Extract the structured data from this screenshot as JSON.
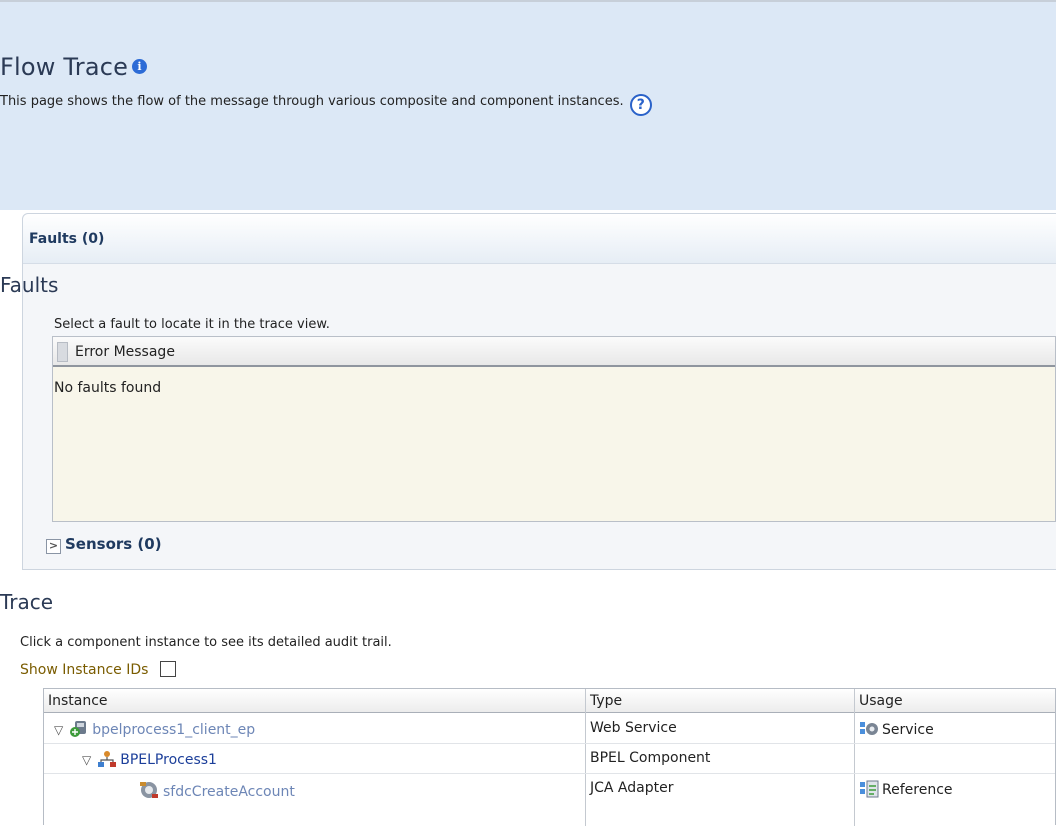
{
  "page": {
    "title": "Flow Trace",
    "description": "This page shows the flow of the message through various composite and component instances."
  },
  "faults": {
    "panel_header": "Faults (0)",
    "heading": "Faults",
    "instruction": "Select a fault to locate it in the trace view.",
    "column_header": "Error Message",
    "empty_text": "No faults found"
  },
  "sensors": {
    "label": "Sensors (0)",
    "expand_glyph": ">"
  },
  "trace": {
    "heading": "Trace",
    "instruction": "Click a component instance to see its detailed audit trail.",
    "show_ids_label": "Show Instance IDs",
    "columns": [
      "Instance",
      "Type",
      "Usage"
    ],
    "rows": [
      {
        "toggle": "▽",
        "instance": "bpelprocess1_client_ep",
        "instance_icon": "web-service-icon",
        "type": "Web Service",
        "usage": "Service",
        "usage_icon": "service-icon"
      },
      {
        "toggle": "▽",
        "instance": "BPELProcess1",
        "instance_icon": "bpel-component-icon",
        "type": "BPEL Component",
        "usage": "",
        "usage_icon": ""
      },
      {
        "toggle": "",
        "instance": "sfdcCreateAccount",
        "instance_icon": "adapter-icon",
        "type": "JCA Adapter",
        "usage": "Reference",
        "usage_icon": "reference-icon"
      }
    ]
  },
  "colors": {
    "top_band": "#dce8f6",
    "heading": "#2b3a55",
    "link_dim": "#6d86b6",
    "link_strong": "#1c3f9a"
  }
}
